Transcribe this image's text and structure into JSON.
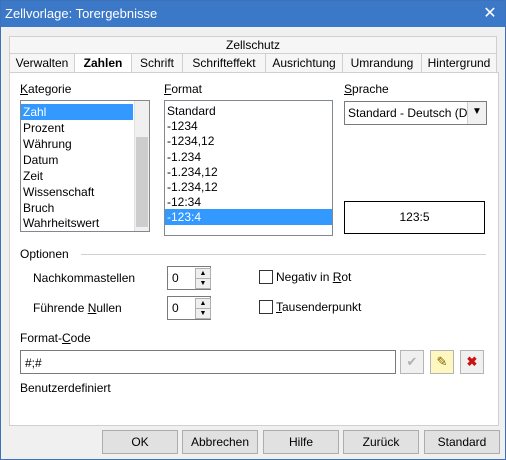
{
  "window": {
    "title": "Zellvorlage: Torergebnisse",
    "close_glyph": "✕"
  },
  "tabs": {
    "top_row": "Zellschutz",
    "items": [
      "Verwalten",
      "Zahlen",
      "Schrift",
      "Schrifteffekt",
      "Ausrichtung",
      "Umrandung",
      "Hintergrund"
    ],
    "active": "Zahlen"
  },
  "category": {
    "label_first": "K",
    "label_rest": "ategorie",
    "items": [
      "Zahl",
      "Prozent",
      "Währung",
      "Datum",
      "Zeit",
      "Wissenschaft",
      "Bruch",
      "Wahrheitswert"
    ],
    "selected": "Zahl"
  },
  "format": {
    "label_first": "F",
    "label_rest": "ormat",
    "items": [
      "Standard",
      "-1234",
      "-1234,12",
      "-1.234",
      "-1.234,12",
      "-1.234,12",
      "-12:34",
      "-123:4"
    ],
    "selected": "-123:4"
  },
  "language": {
    "label_first": "S",
    "label_rest": "prache",
    "value": "Standard - Deutsch (De"
  },
  "preview": {
    "text": "123:5"
  },
  "options": {
    "heading": "Optionen",
    "decimals_label_pre": "Nachkommastellen",
    "decimals_value": "0",
    "leading_label_pre": "Führende ",
    "leading_label_u": "N",
    "leading_label_post": "ullen",
    "leading_value": "0",
    "negative_red_pre": "Negativ in ",
    "negative_red_u": "R",
    "negative_red_post": "ot",
    "negative_red_checked": false,
    "thousands_u": "T",
    "thousands_post": "ausenderpunkt",
    "thousands_checked": false
  },
  "format_code": {
    "label_pre": "Format-",
    "label_u": "C",
    "label_post": "ode",
    "value": "#;#",
    "description": "Benutzerdefiniert"
  },
  "buttons": {
    "ok": "OK",
    "cancel": "Abbrechen",
    "help": "Hilfe",
    "reset": "Zurück",
    "standard": "Standard"
  }
}
